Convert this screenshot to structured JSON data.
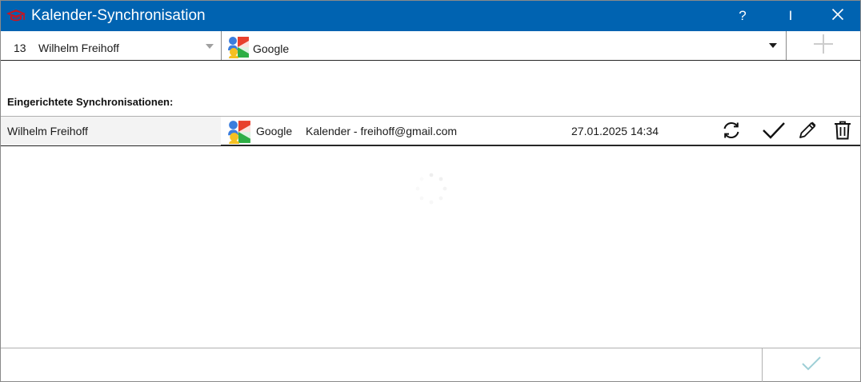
{
  "window": {
    "title": "Kalender-Synchronisation",
    "help_label": "?",
    "cursor_label": "I",
    "accent_color": "#0063b1"
  },
  "toolbar": {
    "user_number": "13",
    "user_name": "Wilhelm Freihoff",
    "provider": "Google",
    "add_icon": "plus-icon"
  },
  "section": {
    "label": "Eingerichtete Synchronisationen:"
  },
  "syncs": [
    {
      "name": "Wilhelm Freihoff",
      "provider": "Google",
      "calendar": "Kalender - freihoff@gmail.com",
      "date": "27.01.2025 14:34",
      "actions": [
        "sync-icon",
        "check-icon",
        "pencil-icon",
        "trash-icon"
      ]
    }
  ],
  "footer": {
    "ok_icon": "check-icon"
  }
}
